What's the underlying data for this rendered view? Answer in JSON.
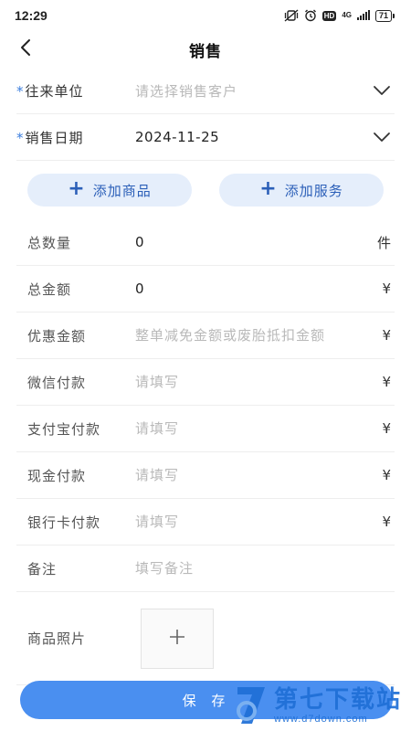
{
  "status_bar": {
    "time": "12:29",
    "network": "4G",
    "hd": "HD",
    "battery": "71"
  },
  "nav": {
    "title": "销售"
  },
  "form": {
    "partner": {
      "label": "往来单位",
      "placeholder": "请选择销售客户",
      "required": true
    },
    "sale_date": {
      "label": "销售日期",
      "value": "2024-11-25",
      "required": true
    },
    "add_product_label": "添加商品",
    "add_service_label": "添加服务",
    "total_qty": {
      "label": "总数量",
      "value": "0",
      "unit": "件"
    },
    "total_amount": {
      "label": "总金额",
      "value": "0",
      "unit": "¥"
    },
    "discount": {
      "label": "优惠金额",
      "placeholder": "整单减免金额或废胎抵扣金额",
      "unit": "¥"
    },
    "wechat_pay": {
      "label": "微信付款",
      "placeholder": "请填写",
      "unit": "¥"
    },
    "alipay": {
      "label": "支付宝付款",
      "placeholder": "请填写",
      "unit": "¥"
    },
    "cash_pay": {
      "label": "现金付款",
      "placeholder": "请填写",
      "unit": "¥"
    },
    "bank_card_pay": {
      "label": "银行卡付款",
      "placeholder": "请填写",
      "unit": "¥"
    },
    "remark": {
      "label": "备注",
      "placeholder": "填写备注"
    },
    "photos": {
      "label": "商品照片"
    }
  },
  "save_label": "保 存",
  "watermark": {
    "brand": "第七下载站",
    "url": "www.d7down.com"
  },
  "colors": {
    "accent": "#4a8ff0",
    "pill_bg": "#e5eefb",
    "pill_text": "#2b5fb8",
    "placeholder": "#b9b9b9",
    "required_star": "#3b7ddd"
  },
  "icons": {
    "back": "chevron-left-icon",
    "dropdown": "chevron-down-icon",
    "add": "plus-icon"
  }
}
